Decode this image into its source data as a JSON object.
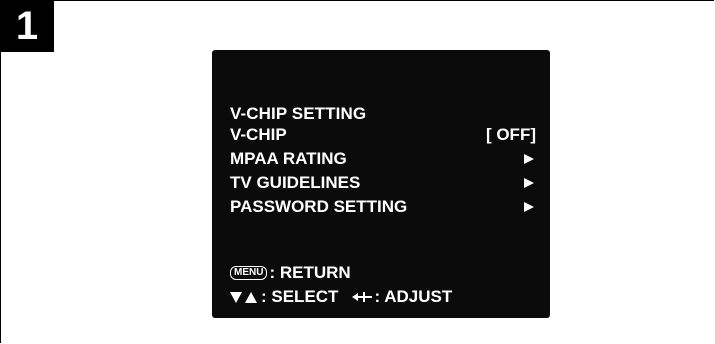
{
  "step": {
    "number": "1"
  },
  "screen": {
    "title": "V-CHIP SETTING",
    "items": [
      {
        "label": "V-CHIP",
        "value": "[ OFF]"
      },
      {
        "label": "MPAA RATING",
        "icon": "arrow-right-icon"
      },
      {
        "label": "TV GUIDELINES",
        "icon": "arrow-right-icon"
      },
      {
        "label": "PASSWORD SETTING",
        "icon": "arrow-right-icon"
      }
    ],
    "footer": {
      "menu_key": "MENU",
      "return_text": ": RETURN",
      "select_text": ": SELECT",
      "adjust_text": ": ADJUST"
    }
  },
  "colors": {
    "screen_bg": "#0b0b0b",
    "text": "#ffffff",
    "badge_bg": "#000000"
  }
}
